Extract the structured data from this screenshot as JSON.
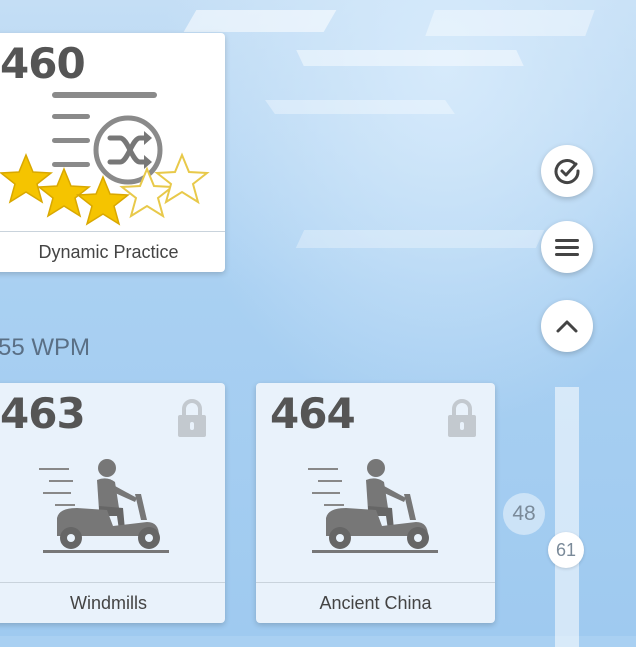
{
  "cards": {
    "top": {
      "number": "460",
      "label": "Dynamic Practice",
      "stars_filled": 3,
      "stars_total": 5
    },
    "left": {
      "number": "463",
      "label": "Windmills",
      "locked": true
    },
    "right": {
      "number": "464",
      "label": "Ancient China",
      "locked": true
    }
  },
  "speed_label": "55 WPM",
  "side_buttons": [
    {
      "icon": "check-circle-icon"
    },
    {
      "icon": "menu-icon"
    },
    {
      "icon": "chevron-up-icon"
    }
  ],
  "progress_markers": [
    {
      "value": "48"
    },
    {
      "value": "61"
    }
  ],
  "colors": {
    "star_gold": "#f5c400",
    "star_outline": "#e8c94a",
    "icon_gray": "#8a8a8a",
    "background": "#a9d0f2"
  }
}
